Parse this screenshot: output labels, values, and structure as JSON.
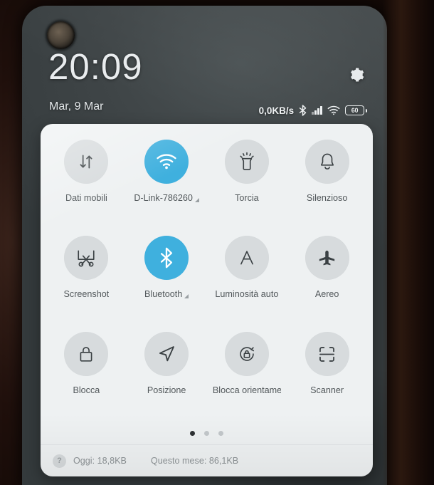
{
  "lockscreen": {
    "time": "20:09",
    "date": "Mar, 9 Mar",
    "settings_icon": "gear-icon"
  },
  "statusbar": {
    "network_speed": "0,0KB/s",
    "bluetooth_icon": "bluetooth-icon",
    "signal_icon": "cellular-signal-icon",
    "wifi_icon": "wifi-icon",
    "battery_level": "60"
  },
  "quick_settings": {
    "tiles": [
      {
        "label": "Dati mobili",
        "icon": "mobile-data-icon",
        "active": false,
        "expandable": false
      },
      {
        "label": "D-Link-786260",
        "icon": "wifi-icon",
        "active": true,
        "expandable": true
      },
      {
        "label": "Torcia",
        "icon": "flashlight-icon",
        "active": false,
        "expandable": false
      },
      {
        "label": "Silenzioso",
        "icon": "bell-icon",
        "active": false,
        "expandable": false
      },
      {
        "label": "Screenshot",
        "icon": "scissors-icon",
        "active": false,
        "expandable": false
      },
      {
        "label": "Bluetooth",
        "icon": "bluetooth-icon",
        "active": true,
        "expandable": true
      },
      {
        "label": "Luminosità auto",
        "icon": "auto-brightness-icon",
        "active": false,
        "expandable": false
      },
      {
        "label": "Aereo",
        "icon": "airplane-icon",
        "active": false,
        "expandable": false
      },
      {
        "label": "Blocca",
        "icon": "lock-icon",
        "active": false,
        "expandable": false
      },
      {
        "label": "Posizione",
        "icon": "location-arrow-icon",
        "active": false,
        "expandable": false
      },
      {
        "label": "Blocca orientame",
        "icon": "rotation-lock-icon",
        "active": false,
        "expandable": false
      },
      {
        "label": "Scanner",
        "icon": "scanner-icon",
        "active": false,
        "expandable": false
      }
    ],
    "pages": {
      "count": 3,
      "active_index": 0
    },
    "footer": {
      "help_icon": "question-mark-icon",
      "today_usage": "Oggi: 18,8KB",
      "month_usage": "Questo mese: 86,1KB"
    }
  },
  "colors": {
    "accent_active": "#3fb0de",
    "panel_background": "#eef1f2",
    "tile_inactive": "#d7dbdd",
    "wallpaper": "#3f4547"
  }
}
